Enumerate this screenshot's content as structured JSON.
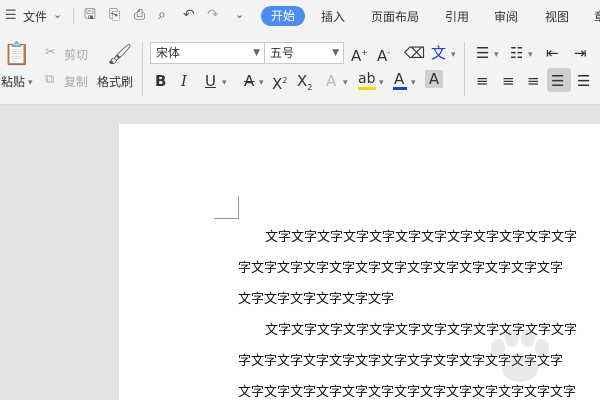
{
  "menubar": {
    "file_label": "文件",
    "tabs": [
      "开始",
      "插入",
      "页面布局",
      "引用",
      "审阅",
      "视图",
      "章"
    ],
    "active_tab": "开始"
  },
  "toolbar": {
    "paste_label": "粘贴",
    "cut_label": "剪切",
    "copy_label": "复制",
    "format_painter_label": "格式刷",
    "font_name": "宋体",
    "font_size": "五号",
    "accent_color": "#4a8cf0",
    "highlight_color": "#f5d800",
    "font_color": "#1a3fd9"
  },
  "document": {
    "lines": [
      "文字文字文字文字文字文字文字文字文字文字文字文字",
      "字文字文字文字文字文字文字文字文字文字文字文字文字",
      "文字文字文字文字文字文字",
      "文字文字文字文字文字文字文字文字文字文字文字文字",
      "字文字文字文字文字文字文字文字文字文字文字文字文字",
      "文字文字文字文字文字文字文字文字文字文字文字文字文字"
    ]
  }
}
